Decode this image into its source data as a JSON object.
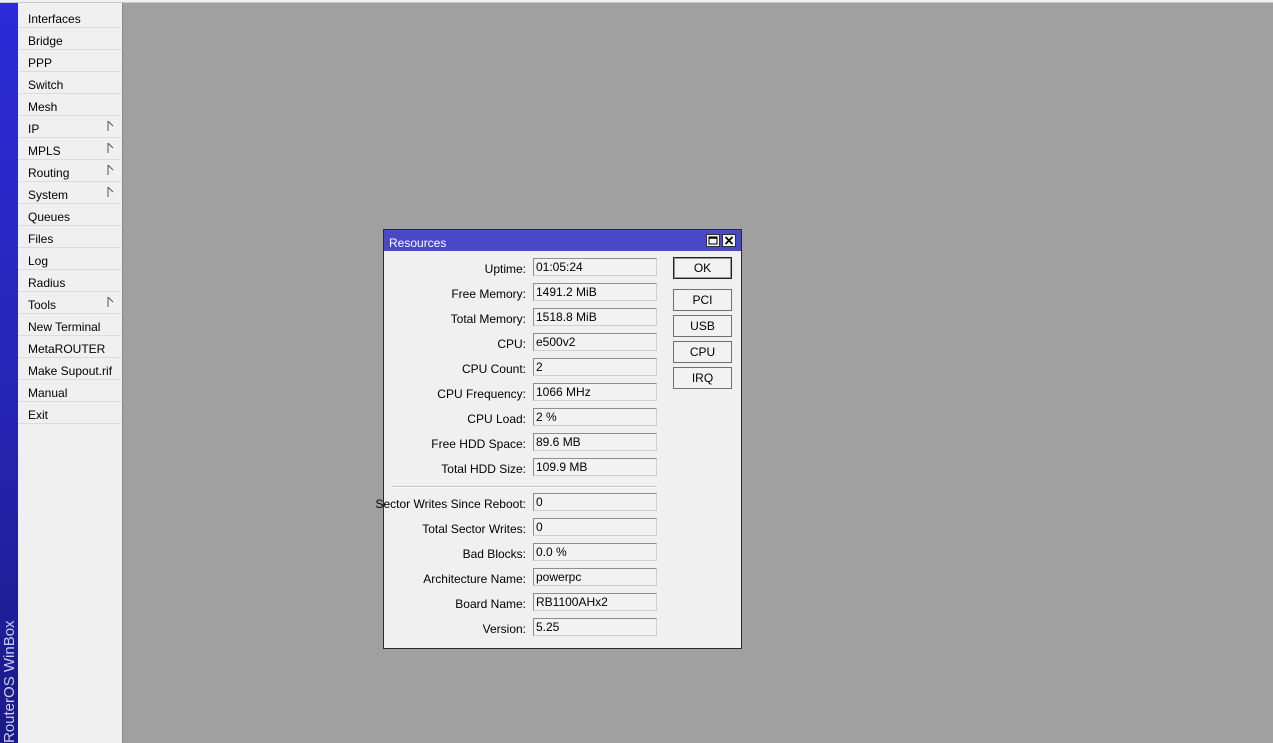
{
  "app": {
    "brand": "RouterOS WinBox"
  },
  "menu": {
    "items": [
      {
        "label": "Interfaces",
        "has_submenu": false
      },
      {
        "label": "Bridge",
        "has_submenu": false
      },
      {
        "label": "PPP",
        "has_submenu": false
      },
      {
        "label": "Switch",
        "has_submenu": false
      },
      {
        "label": "Mesh",
        "has_submenu": false
      },
      {
        "label": "IP",
        "has_submenu": true
      },
      {
        "label": "MPLS",
        "has_submenu": true
      },
      {
        "label": "Routing",
        "has_submenu": true
      },
      {
        "label": "System",
        "has_submenu": true
      },
      {
        "label": "Queues",
        "has_submenu": false
      },
      {
        "label": "Files",
        "has_submenu": false
      },
      {
        "label": "Log",
        "has_submenu": false
      },
      {
        "label": "Radius",
        "has_submenu": false
      },
      {
        "label": "Tools",
        "has_submenu": true
      },
      {
        "label": "New Terminal",
        "has_submenu": false
      },
      {
        "label": "MetaROUTER",
        "has_submenu": false
      },
      {
        "label": "Make Supout.rif",
        "has_submenu": false
      },
      {
        "label": "Manual",
        "has_submenu": false
      },
      {
        "label": "Exit",
        "has_submenu": false
      }
    ]
  },
  "resources_window": {
    "title": "Resources",
    "fields": [
      {
        "label": "Uptime:",
        "value": "01:05:24"
      },
      {
        "label": "Free Memory:",
        "value": "1491.2 MiB"
      },
      {
        "label": "Total Memory:",
        "value": "1518.8 MiB"
      },
      {
        "label": "CPU:",
        "value": "e500v2"
      },
      {
        "label": "CPU Count:",
        "value": "2"
      },
      {
        "label": "CPU Frequency:",
        "value": "1066 MHz"
      },
      {
        "label": "CPU Load:",
        "value": "2 %"
      },
      {
        "label": "Free HDD Space:",
        "value": "89.6 MB"
      },
      {
        "label": "Total HDD Size:",
        "value": "109.9 MB"
      },
      {
        "label": "Sector Writes Since Reboot:",
        "value": "0"
      },
      {
        "label": "Total Sector Writes:",
        "value": "0"
      },
      {
        "label": "Bad Blocks:",
        "value": "0.0 %"
      },
      {
        "label": "Architecture Name:",
        "value": "powerpc"
      },
      {
        "label": "Board Name:",
        "value": "RB1100AHx2"
      },
      {
        "label": "Version:",
        "value": "5.25"
      }
    ],
    "buttons": {
      "ok": "OK",
      "pci": "PCI",
      "usb": "USB",
      "cpu": "CPU",
      "irq": "IRQ"
    }
  },
  "colors": {
    "titlebar": "#4848c8",
    "sidebar_strip": "#2525b4",
    "desktop": "#a0a0a0"
  }
}
